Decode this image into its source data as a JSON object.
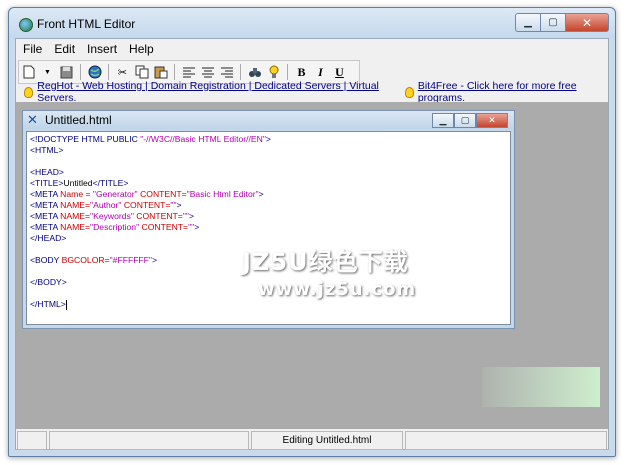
{
  "window": {
    "title": "Front HTML Editor"
  },
  "menu": [
    "File",
    "Edit",
    "Insert",
    "Help"
  ],
  "toolbar": {
    "bold": "B",
    "italic": "I",
    "underline": "U"
  },
  "links": {
    "reghot": "RegHot - Web Hosting | Domain Registration | Dedicated Servers | Virtual Servers.",
    "bit4free": "Bit4Free - Click here for more free programs."
  },
  "document": {
    "title": "Untitled.html",
    "lines": [
      {
        "parts": [
          {
            "c": "tag",
            "t": "<!DOCTYPE HTML PUBLIC "
          },
          {
            "c": "str",
            "t": "\"-//W3C//Basic HTML Editor//EN\""
          },
          {
            "c": "tag",
            "t": ">"
          }
        ]
      },
      {
        "parts": [
          {
            "c": "tag",
            "t": "<HTML>"
          }
        ]
      },
      {
        "parts": []
      },
      {
        "parts": [
          {
            "c": "tag",
            "t": "<HEAD>"
          }
        ]
      },
      {
        "parts": [
          {
            "c": "tag",
            "t": "<TITLE>"
          },
          {
            "c": "txt",
            "t": "Untitled"
          },
          {
            "c": "tag",
            "t": "</TITLE>"
          }
        ]
      },
      {
        "parts": [
          {
            "c": "tag",
            "t": "<META "
          },
          {
            "c": "attr",
            "t": "Name = "
          },
          {
            "c": "str",
            "t": "\"Generator\""
          },
          {
            "c": "attr",
            "t": " CONTENT="
          },
          {
            "c": "str",
            "t": "\"Basic Html Editor\""
          },
          {
            "c": "tag",
            "t": ">"
          }
        ]
      },
      {
        "parts": [
          {
            "c": "tag",
            "t": "<META "
          },
          {
            "c": "attr",
            "t": "NAME="
          },
          {
            "c": "str",
            "t": "\"Author\""
          },
          {
            "c": "attr",
            "t": " CONTENT="
          },
          {
            "c": "str",
            "t": "\"\""
          },
          {
            "c": "tag",
            "t": ">"
          }
        ]
      },
      {
        "parts": [
          {
            "c": "tag",
            "t": "<META "
          },
          {
            "c": "attr",
            "t": "NAME="
          },
          {
            "c": "str",
            "t": "\"Keywords\""
          },
          {
            "c": "attr",
            "t": " CONTENT="
          },
          {
            "c": "str",
            "t": "\"\""
          },
          {
            "c": "tag",
            "t": ">"
          }
        ]
      },
      {
        "parts": [
          {
            "c": "tag",
            "t": "<META "
          },
          {
            "c": "attr",
            "t": "NAME="
          },
          {
            "c": "str",
            "t": "\"Description\""
          },
          {
            "c": "attr",
            "t": " CONTENT="
          },
          {
            "c": "str",
            "t": "\"\""
          },
          {
            "c": "tag",
            "t": ">"
          }
        ]
      },
      {
        "parts": [
          {
            "c": "tag",
            "t": "</HEAD>"
          }
        ]
      },
      {
        "parts": []
      },
      {
        "parts": [
          {
            "c": "tag",
            "t": "<BODY "
          },
          {
            "c": "attr",
            "t": "BGCOLOR="
          },
          {
            "c": "str",
            "t": "\"#FFFFFF\""
          },
          {
            "c": "tag",
            "t": ">"
          }
        ]
      },
      {
        "parts": []
      },
      {
        "parts": [
          {
            "c": "tag",
            "t": "</BODY>"
          }
        ]
      },
      {
        "parts": []
      },
      {
        "parts": [
          {
            "c": "tag",
            "t": "</HTML>"
          }
        ]
      }
    ]
  },
  "watermark": {
    "line1": "JZ5U绿色下载",
    "line2": "www.jz5u.com"
  },
  "status": {
    "message": "Editing Untitled.html"
  },
  "colors": {
    "tag": "#000080",
    "attr": "#cc0000",
    "string": "#b000b0",
    "mdi_background": "#ababab"
  }
}
